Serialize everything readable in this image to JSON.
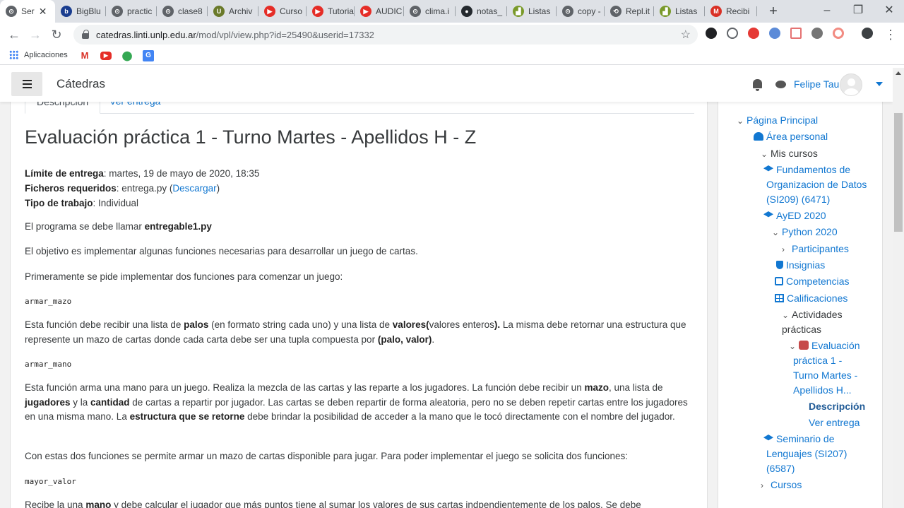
{
  "browser": {
    "tabs": [
      {
        "label": "Ser",
        "color": "#5f6368",
        "active": true,
        "glyph": "⊙"
      },
      {
        "label": "BigBlu",
        "color": "#1a3d8f",
        "glyph": "b"
      },
      {
        "label": "practic",
        "color": "#5f6368",
        "glyph": "⊙"
      },
      {
        "label": "clase8",
        "color": "#5f6368",
        "glyph": "⊙"
      },
      {
        "label": "Archiv",
        "color": "#6a7a2a",
        "glyph": "U"
      },
      {
        "label": "Curso",
        "color": "#e52d27",
        "glyph": "▶"
      },
      {
        "label": "Tutoria",
        "color": "#e52d27",
        "glyph": "▶"
      },
      {
        "label": "AUDIC",
        "color": "#e52d27",
        "glyph": "▶"
      },
      {
        "label": "clima.i",
        "color": "#5f6368",
        "glyph": "⊙"
      },
      {
        "label": "notas_",
        "color": "#24292e",
        "glyph": "●"
      },
      {
        "label": "Listas",
        "color": "#7a9a2a",
        "glyph": "▟"
      },
      {
        "label": "copy -",
        "color": "#5f6368",
        "glyph": "⊙"
      },
      {
        "label": "Repl.it",
        "color": "#5f6368",
        "glyph": "⟲"
      },
      {
        "label": "Listas",
        "color": "#7a9a2a",
        "glyph": "▟"
      },
      {
        "label": "Recibi",
        "color": "#d93025",
        "glyph": "M"
      }
    ],
    "url_host": "catedras.linti.unlp.edu.ar",
    "url_path": "/mod/vpl/view.php?id=25490&userid=17332",
    "bookmarks_label": "Aplicaciones"
  },
  "header": {
    "site_name": "Cátedras",
    "user_name": "Felipe Tau"
  },
  "main": {
    "tabs": [
      "Descripción",
      "Ver entrega"
    ],
    "title": "Evaluación práctica 1 - Turno Martes - Apellidos H - Z",
    "due_label": "Límite de entrega",
    "due_value": ": martes, 19 de mayo de 2020, 18:35",
    "files_label": "Ficheros requeridos",
    "files_value": ": entrega.py (",
    "files_link": "Descargar",
    "files_close": ")",
    "work_label": "Tipo de trabajo",
    "work_value": ": Individual",
    "p1_text": "El programa se debe llamar ",
    "p1_bold": "entregable1.py",
    "p2": "El objetivo es implementar algunas funciones necesarias para desarrollar un juego de cartas.",
    "p3": "Primeramente se pide implementar dos funciones para comenzar un juego:",
    "code1": "armar_mazo",
    "p4_a": "Esta función debe recibir una lista de ",
    "p4_b": "palos",
    "p4_c": " (en formato string cada uno) y una lista de ",
    "p4_d": "valores(",
    "p4_e": "valores enteros",
    "p4_f": ").",
    "p4_g": " La misma debe retornar una estructura que represente un mazo de cartas donde cada carta debe ser una tupla compuesta por ",
    "p4_h": "(palo, valor)",
    "p4_i": ".",
    "code2": "armar_mano",
    "p5_a": "Esta función arma una mano para un juego. Realiza la mezcla de las cartas y las reparte a los jugadores. La función debe recibir un ",
    "p5_b": "mazo",
    "p5_c": ", una lista de ",
    "p5_d": "jugadores",
    "p5_e": " y la ",
    "p5_f": "cantidad",
    "p5_g": " de cartas a repartir por jugador. Las cartas se deben repartir de forma aleatoria, pero no se deben repetir cartas entre los jugadores en una misma mano. La ",
    "p5_h": "estructura que se retorne",
    "p5_i": " debe brindar la posibilidad de acceder a la mano que le tocó directamente con el nombre del jugador.",
    "p6": "Con estas dos funciones se permite armar un mazo de cartas disponible para jugar. Para poder implementar el juego se solicita dos funciones:",
    "code3": "mayor_valor",
    "p7_a": "Recibe la una ",
    "p7_b": "mano",
    "p7_c": " y debe calcular el jugador que más  puntos tiene al sumar los valores de sus cartas indpendientemente de los palos. Se debe"
  },
  "nav": {
    "items": [
      "Página Principal",
      "Área personal",
      "Mis cursos",
      "Fundamentos de",
      "Organizacion de Datos",
      "(SI209) (6471)",
      "AyED 2020",
      "Python 2020",
      "Participantes",
      "Insignias",
      "Competencias",
      "Calificaciones",
      "Actividades",
      "prácticas",
      "Evaluación",
      "práctica 1 -",
      "Turno Martes -",
      "Apellidos H...",
      "Descripción",
      "Ver entrega",
      "Seminario de",
      "Lenguajes (SI207)",
      "(6587)",
      "Cursos"
    ]
  }
}
